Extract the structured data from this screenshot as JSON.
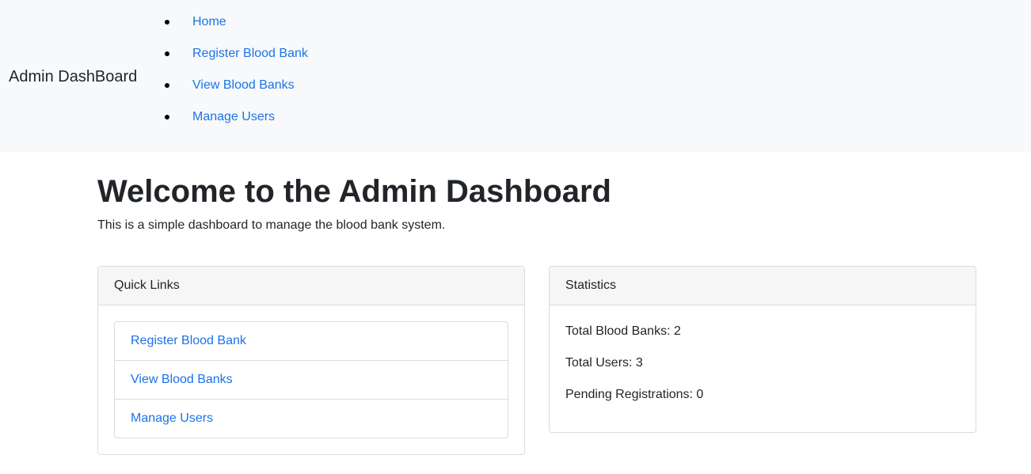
{
  "navbar": {
    "brand": "Admin DashBoard",
    "items": [
      {
        "label": "Home"
      },
      {
        "label": "Register Blood Bank"
      },
      {
        "label": "View Blood Banks"
      },
      {
        "label": "Manage Users"
      }
    ]
  },
  "main": {
    "title": "Welcome to the Admin Dashboard",
    "subtitle": "This is a simple dashboard to manage the blood bank system."
  },
  "quick_links": {
    "header": "Quick Links",
    "items": [
      {
        "label": "Register Blood Bank"
      },
      {
        "label": "View Blood Banks"
      },
      {
        "label": "Manage Users"
      }
    ]
  },
  "statistics": {
    "header": "Statistics",
    "lines": [
      {
        "text": "Total Blood Banks: 2"
      },
      {
        "text": "Total Users: 3"
      },
      {
        "text": "Pending Registrations: 0"
      }
    ]
  },
  "colors": {
    "link": "#1a73e8",
    "navbar_bg": "#f8f9fa",
    "card_header_bg": "#f6f6f6",
    "border": "#dcdcdc",
    "text": "#212529"
  }
}
